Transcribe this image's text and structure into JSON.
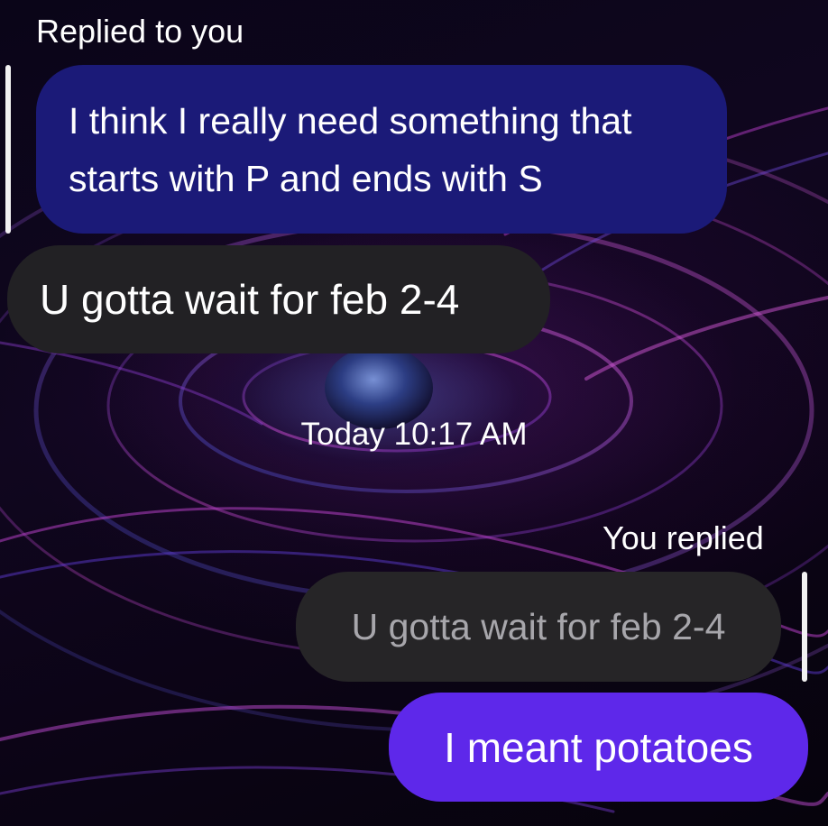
{
  "theme": {
    "quoted_received_color": "#1b1a78",
    "received_bubble_color": "#222124",
    "quoted_sent_color": "#262527",
    "sent_bubble_color": "#5e28ea"
  },
  "conversation": {
    "reply_header_in": "Replied to you",
    "quoted_received_text": "I think I really need something that starts with P and ends with S",
    "received_message": "U gotta wait for feb 2-4",
    "timestamp": "Today 10:17 AM",
    "reply_header_out": "You replied",
    "quoted_sent_text": "U gotta wait for feb 2-4",
    "sent_message": "I meant potatoes"
  }
}
